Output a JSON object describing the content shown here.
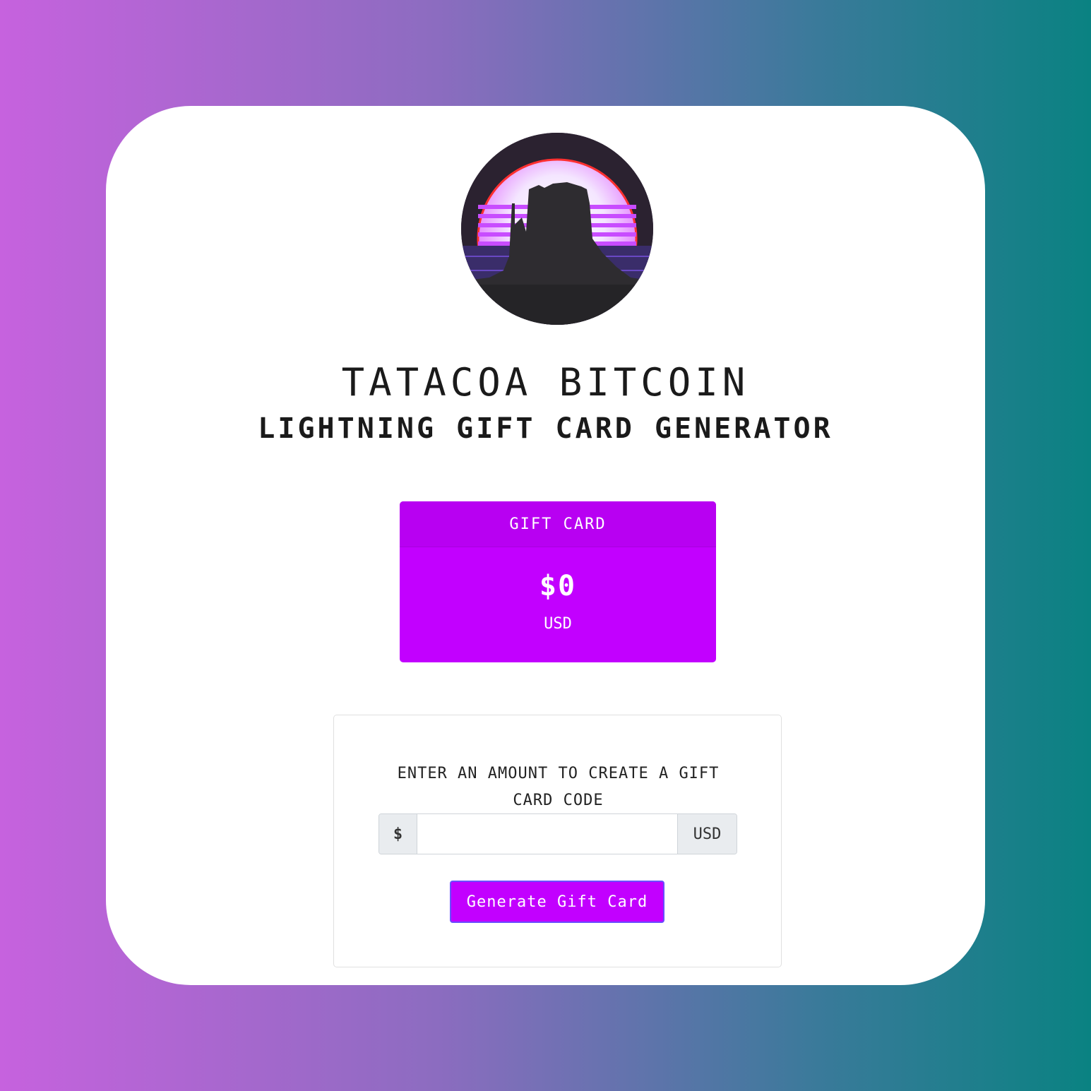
{
  "colors": {
    "background_left": "#c662de",
    "background_right": "#0a8282",
    "accent": "#c200ff",
    "text": "#1a1a1a"
  },
  "logo": {
    "icon": "desert-butte-retro-sun-logo"
  },
  "header": {
    "title": "TATACOA BITCOIN",
    "subtitle": "LIGHTNING GIFT CARD GENERATOR"
  },
  "gift_card": {
    "label": "GIFT CARD",
    "amount": "$0",
    "currency": "USD"
  },
  "form": {
    "prompt": "ENTER AN AMOUNT TO CREATE A GIFT CARD CODE",
    "prefix": "$",
    "suffix": "USD",
    "amount_value": "",
    "amount_placeholder": "",
    "button_label": "Generate Gift Card"
  }
}
